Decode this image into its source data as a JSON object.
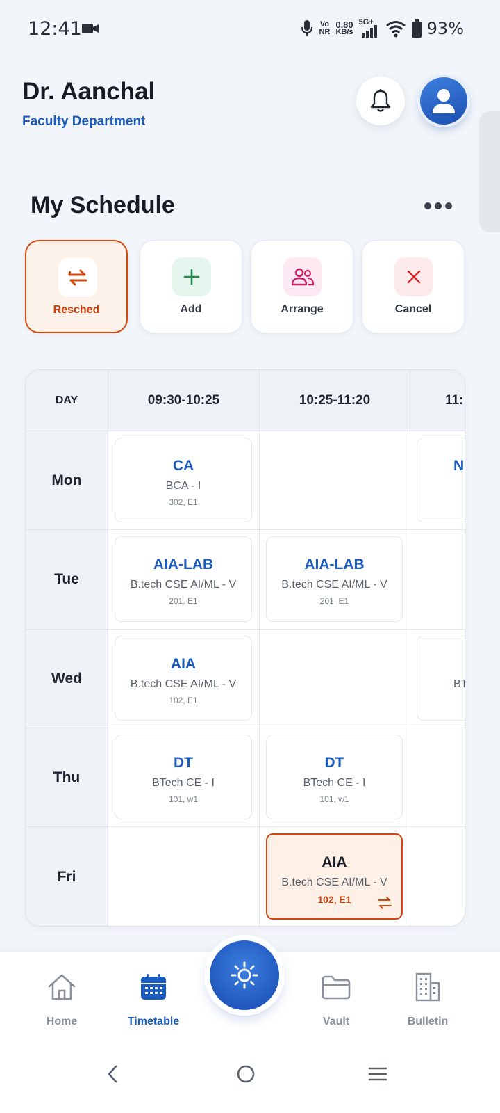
{
  "status_bar": {
    "time": "12:41",
    "volte_top": "Vo",
    "volte_bottom": "NR",
    "speed_top": "0.80",
    "speed_bottom": "KB/s",
    "network": "5G+",
    "battery": "93%"
  },
  "header": {
    "name": "Dr. Aanchal",
    "department": "Faculty Department"
  },
  "schedule": {
    "title": "My Schedule",
    "actions": [
      {
        "label": "Resched",
        "icon": "swap-icon",
        "active": true
      },
      {
        "label": "Add",
        "icon": "plus-icon",
        "active": false
      },
      {
        "label": "Arrange",
        "icon": "people-icon",
        "active": false
      },
      {
        "label": "Cancel",
        "icon": "close-icon",
        "active": false
      }
    ]
  },
  "timetable": {
    "headers": [
      "DAY",
      "09:30-10:25",
      "10:25-11:20",
      "11:"
    ],
    "days": [
      "Mon",
      "Tue",
      "Wed",
      "Thu",
      "Fri"
    ],
    "slots": {
      "mon1": {
        "subject": "CA",
        "class": "BCA - I",
        "room": "302, E1"
      },
      "mon3": {
        "subject": "N",
        "class": "",
        "room": ""
      },
      "tue1": {
        "subject": "AIA-LAB",
        "class": "B.tech CSE AI/ML - V",
        "room": "201, E1"
      },
      "tue2": {
        "subject": "AIA-LAB",
        "class": "B.tech CSE AI/ML - V",
        "room": "201, E1"
      },
      "wed1": {
        "subject": "AIA",
        "class": "B.tech CSE AI/ML - V",
        "room": "102, E1"
      },
      "wed3": {
        "subject": "",
        "class": "BT",
        "room": ""
      },
      "thu1": {
        "subject": "DT",
        "class": "BTech CE - I",
        "room": "101, w1"
      },
      "thu2": {
        "subject": "DT",
        "class": "BTech CE - I",
        "room": "101, w1"
      },
      "fri2": {
        "subject": "AIA",
        "class": "B.tech CSE AI/ML - V",
        "room": "102, E1",
        "rescheduled": true
      }
    }
  },
  "bottom_nav": {
    "items": [
      {
        "label": "Home",
        "icon": "home-icon"
      },
      {
        "label": "Timetable",
        "icon": "calendar-icon",
        "active": true
      },
      {
        "label": "Vault",
        "icon": "folder-icon"
      },
      {
        "label": "Bulletin",
        "icon": "building-icon"
      }
    ],
    "center_icon": "sun-icon"
  },
  "colors": {
    "primary": "#1a5bbd",
    "accent": "#d24a10",
    "background": "#f2f6fa"
  }
}
